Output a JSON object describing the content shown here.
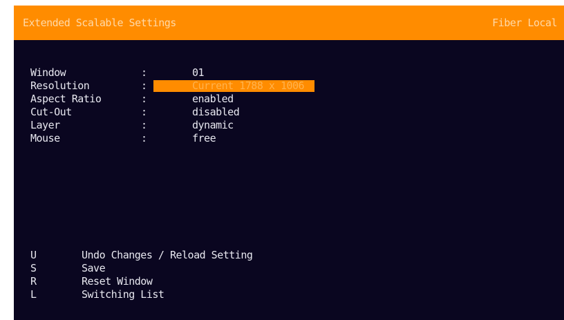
{
  "header": {
    "title": "Extended Scalable Settings",
    "source": "Fiber Local"
  },
  "settings": [
    {
      "label": "Window",
      "separator": ":",
      "value": "01"
    },
    {
      "label": "Resolution",
      "separator": ":",
      "value": "Current 1788 x 1006",
      "selected": true
    },
    {
      "label": "Aspect Ratio",
      "separator": ":",
      "value": "enabled"
    },
    {
      "label": "Cut-Out",
      "separator": ":",
      "value": "disabled"
    },
    {
      "label": "Layer",
      "separator": ":",
      "value": "dynamic"
    },
    {
      "label": "Mouse",
      "separator": ":",
      "value": "free"
    }
  ],
  "shortcuts": [
    {
      "key": "U",
      "action": "Undo Changes / Reload Setting"
    },
    {
      "key": "S",
      "action": "Save"
    },
    {
      "key": "R",
      "action": "Reset Window"
    },
    {
      "key": "L",
      "action": "Switching List"
    }
  ],
  "colors": {
    "accent": "#ff8c00",
    "background": "#0a0620",
    "text": "#e8e8f0"
  }
}
